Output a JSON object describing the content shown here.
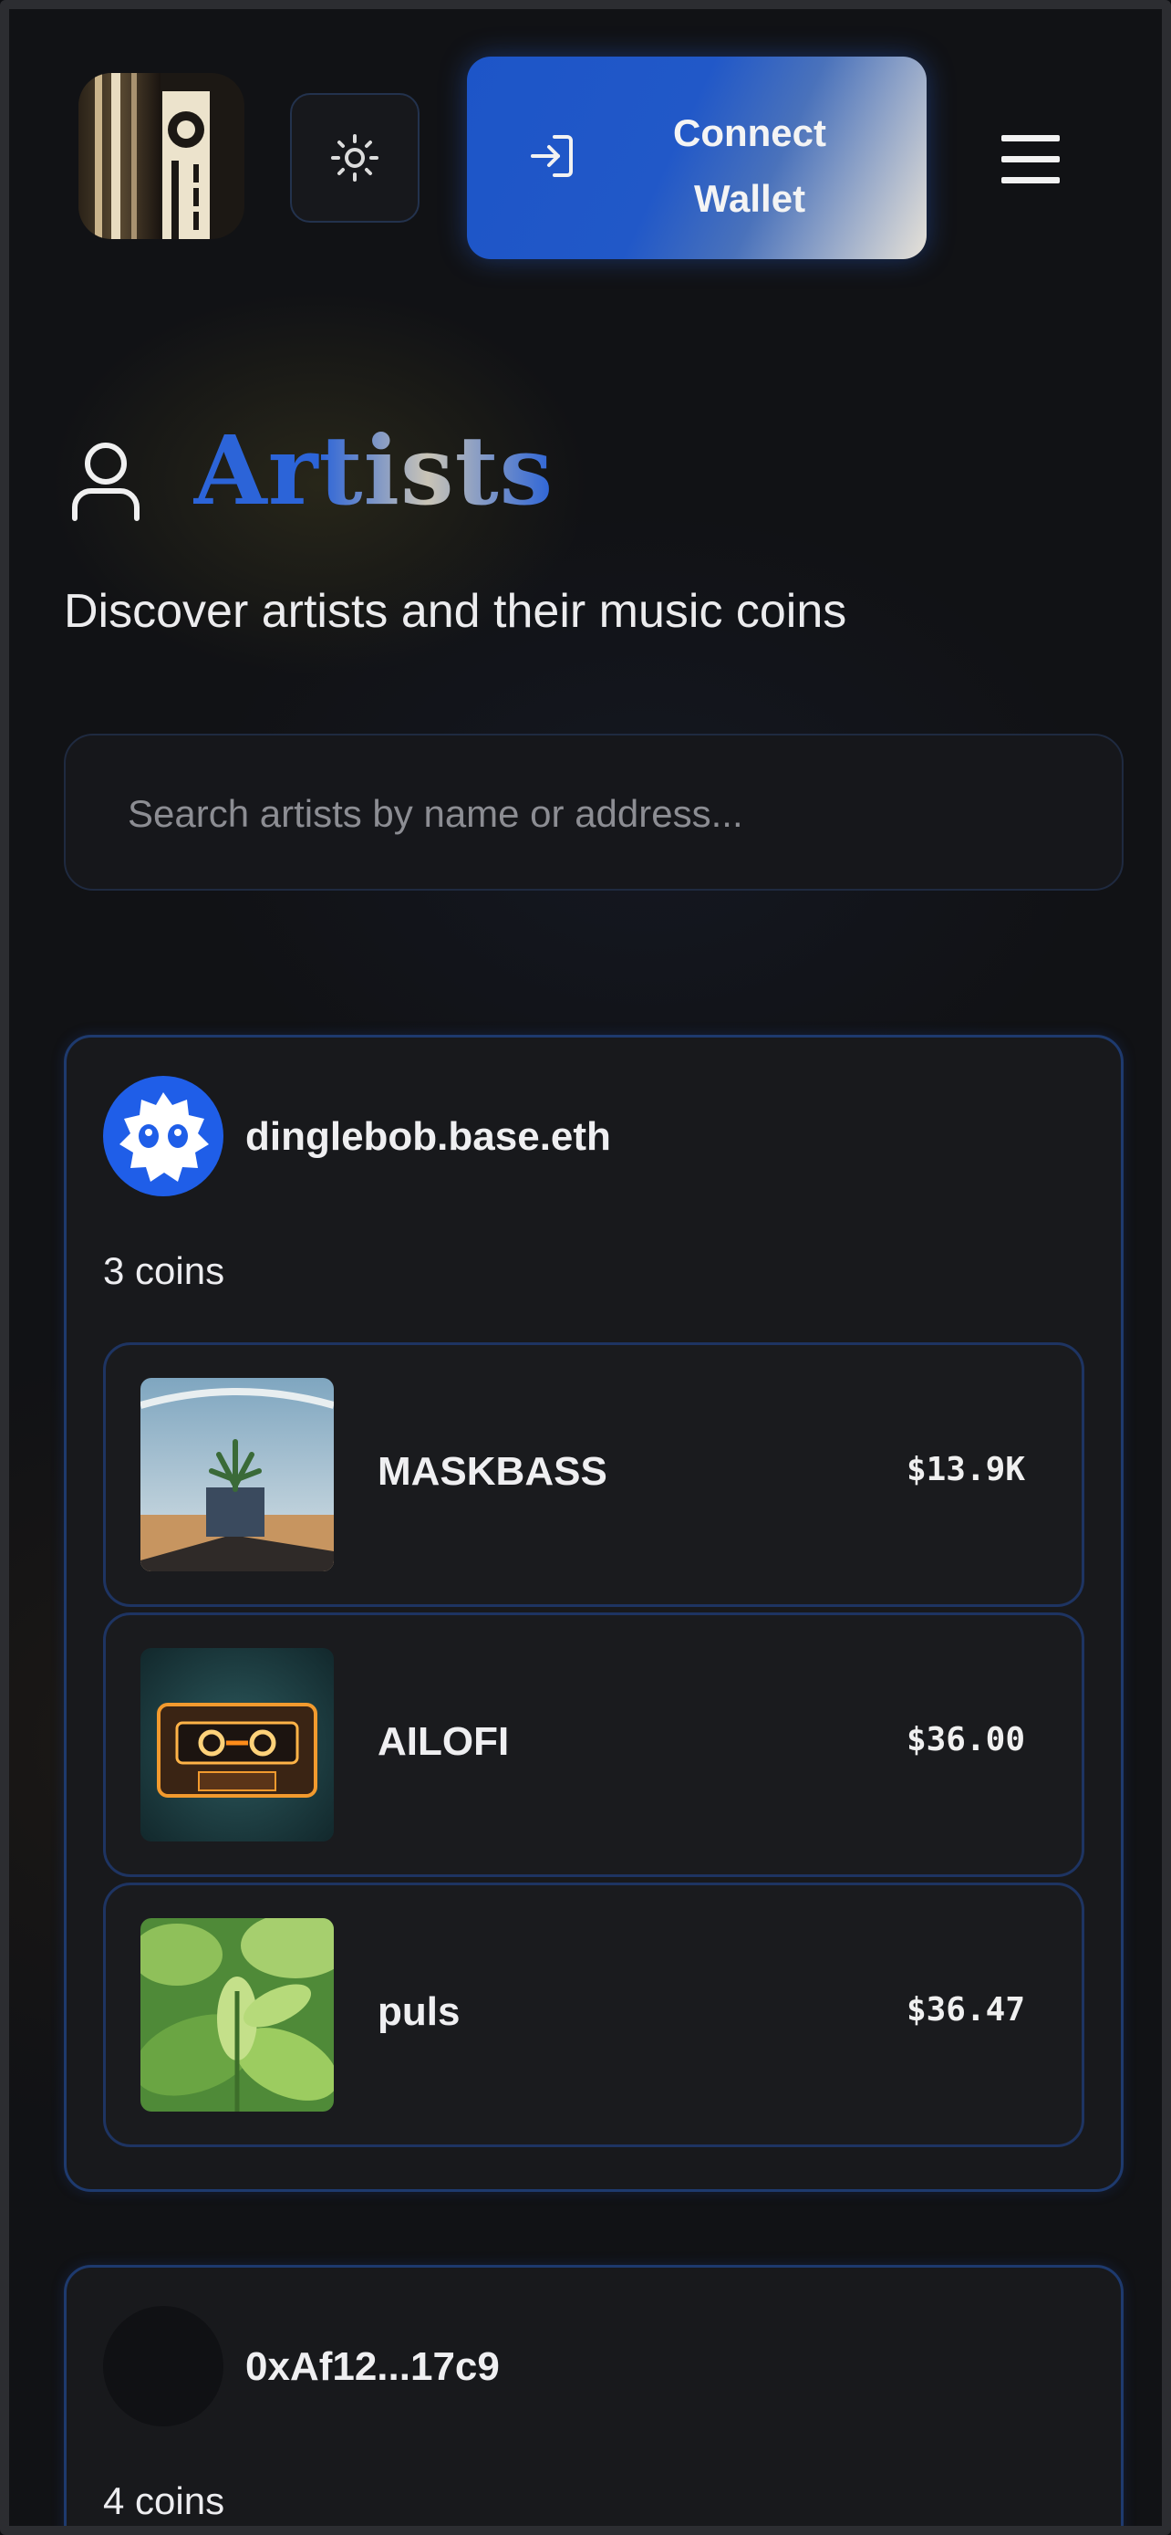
{
  "header": {
    "logo_icon": "music-logo",
    "theme_icon": "sun-icon",
    "connect_label_line1": "Connect",
    "connect_label_line2": "Wallet",
    "connect_icon": "login-icon",
    "menu_icon": "hamburger-menu-icon"
  },
  "page": {
    "title": "Artists",
    "title_icon": "user-icon",
    "subtitle": "Discover artists and their music coins"
  },
  "search": {
    "placeholder": "Search artists by name or address..."
  },
  "artists": [
    {
      "name": "dinglebob.base.eth",
      "coin_count": "3 coins",
      "coins": [
        {
          "name": "MASKBASS",
          "price": "$13.9K"
        },
        {
          "name": "AILOFI",
          "price": "$36.00"
        },
        {
          "name": "puls",
          "price": "$36.47"
        }
      ]
    },
    {
      "name": "0xAf12...17c9",
      "coin_count": "4 coins"
    }
  ],
  "colors": {
    "accent": "#1d55c8",
    "border": "#1e3a6e",
    "background": "#111215"
  }
}
